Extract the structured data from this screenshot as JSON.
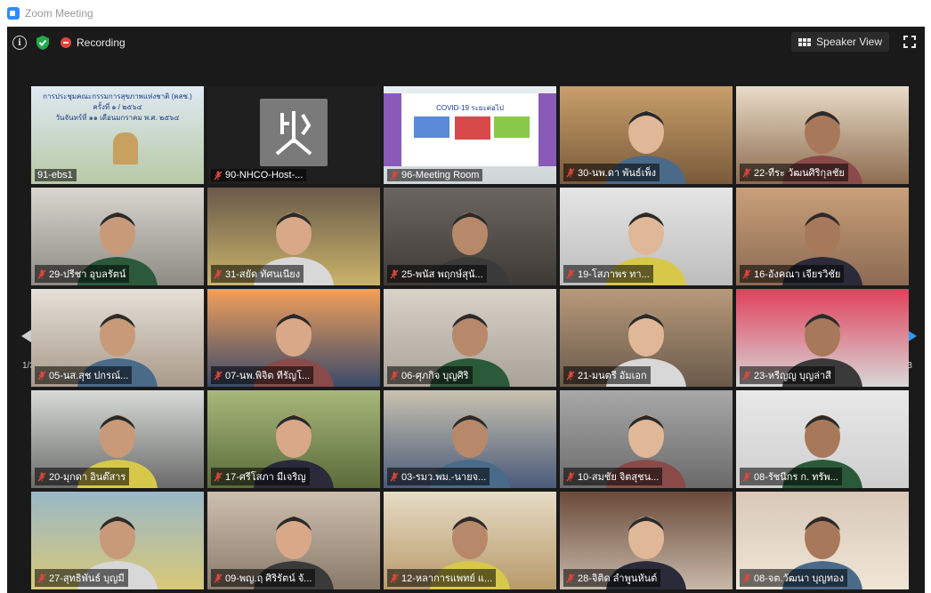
{
  "window": {
    "title": "Zoom Meeting"
  },
  "toolbar": {
    "recording_label": "Recording",
    "speaker_view_label": "Speaker View",
    "icons": [
      "info-icon",
      "shield-icon",
      "recording-icon",
      "speaker-view-icon",
      "fullscreen-icon"
    ]
  },
  "pagination": {
    "left": "1/3",
    "right": "1/3"
  },
  "colors": {
    "stage": "#1a1a1a",
    "active_speaker": "#d6d04a",
    "mute": "#e2463a",
    "accent": "#2d8cff"
  },
  "participants": [
    {
      "name": "91-ebs1",
      "muted": false,
      "slide_lines": [
        "การประชุมคณะกรรมการสุขภาพแห่งชาติ (คสช.)",
        "ครั้งที่ ๑ / ๒๕๖๔",
        "วันจันทร์ที่ ๑๑ เดือนมกราคม พ.ศ. ๒๕๖๔"
      ]
    },
    {
      "name": "90-NHCO-Host-...",
      "muted": true
    },
    {
      "name": "96-Meeting Room",
      "muted": true,
      "active": true,
      "slide_heading": "COVID-19 ระยะต่อไป"
    },
    {
      "name": "30-นพ.ดา พันธ์เพ็ง",
      "muted": true
    },
    {
      "name": "22-ทีระ วัฒนศิริกุลชัย",
      "muted": true
    },
    {
      "name": "29-ปรีชา อุบลรัตน์",
      "muted": true
    },
    {
      "name": "31-สยัด ทัศนเนียง",
      "muted": true
    },
    {
      "name": "25-พนัส พฤกษ์สุนั...",
      "muted": true
    },
    {
      "name": "19-โสภาพร ทา...",
      "muted": true
    },
    {
      "name": "16-อังคณา เจียรวิชัย",
      "muted": true
    },
    {
      "name": "05-นส.สุช ปกรณ์...",
      "muted": true
    },
    {
      "name": "07-นพ.พิจิต ทีรัญโ...",
      "muted": true
    },
    {
      "name": "06-ศุภกิจ บุญศิริ",
      "muted": true
    },
    {
      "name": "21-มนตรี อัมเอก",
      "muted": true
    },
    {
      "name": "23-หรีญญ บุญล่าสี",
      "muted": true
    },
    {
      "name": "20-มุกดา อินต๊สาร",
      "muted": true
    },
    {
      "name": "17-ศรีโสภา มีเจริญ",
      "muted": true
    },
    {
      "name": "03-รมว.พม.-นายจ...",
      "muted": true
    },
    {
      "name": "10-สมชัย จิตสุชน...",
      "muted": true
    },
    {
      "name": "08-รัชนีกร ก. ทรัพ...",
      "muted": true
    },
    {
      "name": "27-สุทธิพันธ์ บุญมี",
      "muted": true
    },
    {
      "name": "09-พญ.ฤ ศิริรัตน์ จั...",
      "muted": true
    },
    {
      "name": "12-หลาการแพทย์ แ...",
      "muted": true
    },
    {
      "name": "28-จิติด ลำพูนหันต์",
      "muted": true
    },
    {
      "name": "08-จต.วัฒนา บุญทอง",
      "muted": true
    }
  ]
}
